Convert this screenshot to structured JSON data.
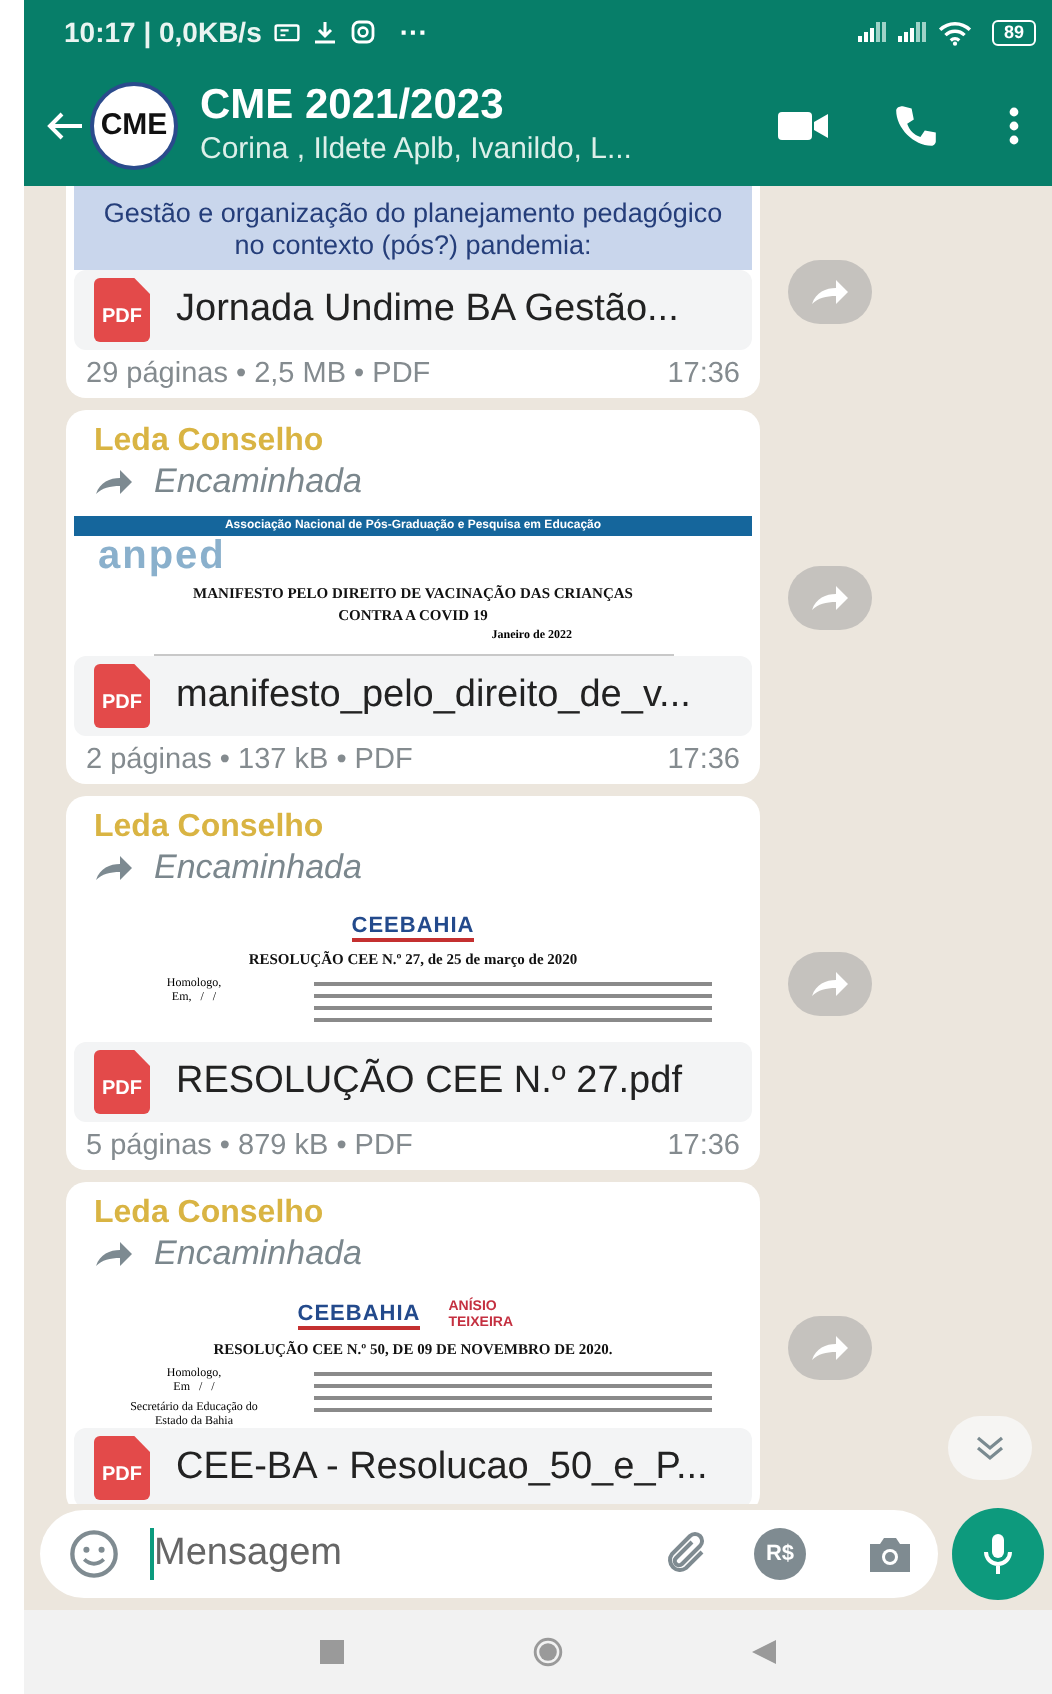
{
  "status_bar": {
    "time": "10:17 | 0,0KB/s",
    "more": "···",
    "battery": "89"
  },
  "header": {
    "avatar_text": "CME",
    "title": "CME 2021/2023",
    "subtitle": "Corina , Ildete Aplb, Ivanildo, L..."
  },
  "messages": [
    {
      "preview": {
        "items": [
          {
            "kind": "caption",
            "text": "Gestão e organização do planejamento pedagógico no contexto (pós?) pandemia:"
          }
        ]
      },
      "file_icon": "PDF",
      "file_name": "Jornada Undime BA Gestão...",
      "details": "29 páginas • 2,5 MB • PDF",
      "time": "17:36"
    },
    {
      "sender": "Leda Conselho",
      "color": "#d9b443",
      "forwarded": "Encaminhada",
      "preview": {
        "items": [
          {
            "kind": "band",
            "text": "Associação Nacional de Pós-Graduação e Pesquisa em Educação"
          },
          {
            "kind": "wordmark",
            "text": "anped"
          },
          {
            "kind": "heading",
            "text": "MANIFESTO PELO DIREITO DE VACINAÇÃO DAS CRIANÇAS CONTRA A COVID 19"
          },
          {
            "kind": "date",
            "text": "Janeiro de 2022"
          }
        ]
      },
      "file_icon": "PDF",
      "file_name": "manifesto_pelo_direito_de_v...",
      "details": "2 páginas • 137 kB • PDF",
      "time": "17:36"
    },
    {
      "sender": "Leda Conselho",
      "color": "#d9b443",
      "forwarded": "Encaminhada",
      "preview": {
        "items": [
          {
            "kind": "logos",
            "texts": [
              "CEEBAHIA"
            ]
          },
          {
            "kind": "heading",
            "text": "RESOLUÇÃO CEE N.º 27, de 25 de março de 2020"
          },
          {
            "kind": "body",
            "texts": [
              "Homologo,",
              "Em,   /   /"
            ]
          }
        ]
      },
      "file_icon": "PDF",
      "file_name": "RESOLUÇÃO CEE N.º 27.pdf",
      "details": "5 páginas • 879 kB • PDF",
      "time": "17:36"
    },
    {
      "sender": "Leda Conselho",
      "color": "#d9b443",
      "forwarded": "Encaminhada",
      "preview": {
        "items": [
          {
            "kind": "logos",
            "texts": [
              "CEEBAHIA",
              "ANÍSIO TEIXEIRA"
            ]
          },
          {
            "kind": "heading",
            "text": "RESOLUÇÃO CEE N.º 50, DE 09 DE NOVEMBRO DE 2020."
          },
          {
            "kind": "body",
            "texts": [
              "Homologo,",
              "Em   /   /",
              "Secretário da Educação do Estado da Bahia"
            ]
          }
        ]
      },
      "file_icon": "PDF",
      "file_name": "CEE-BA - Resolucao_50_e_P..."
    }
  ],
  "composer": {
    "placeholder": "Mensagem",
    "currency": "R$"
  }
}
